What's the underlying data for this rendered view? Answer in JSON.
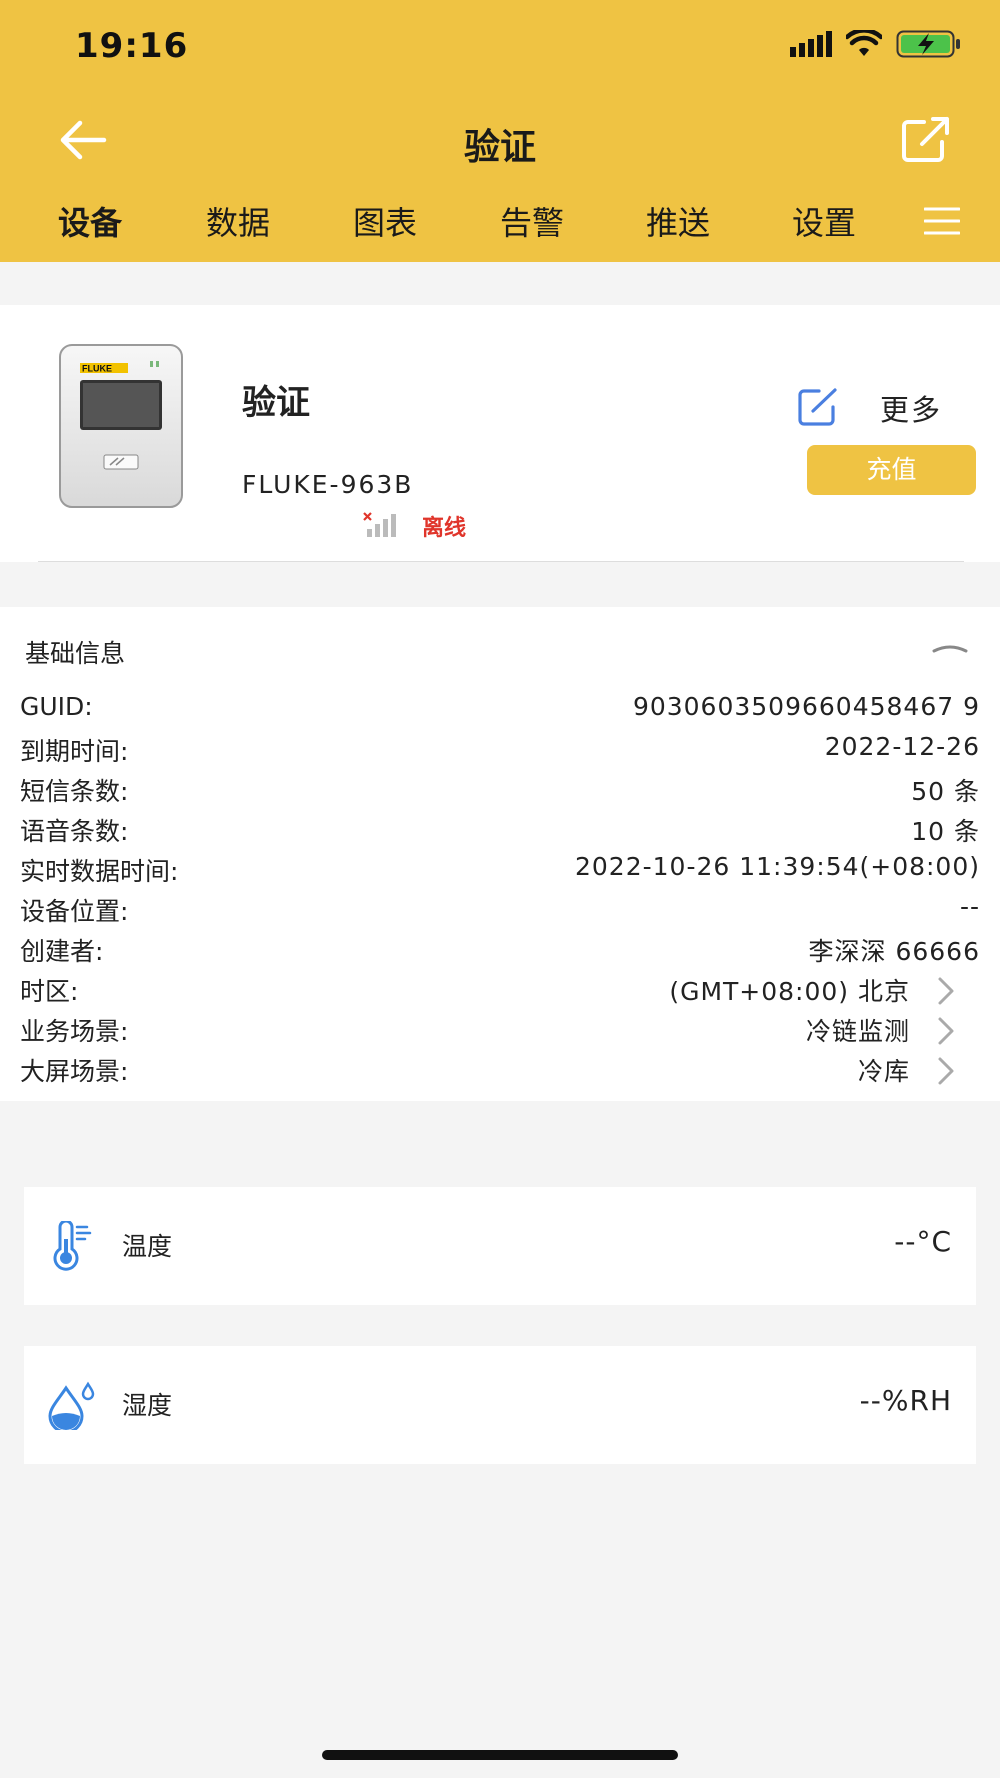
{
  "status_bar": {
    "time": "19:16"
  },
  "nav": {
    "title": "验证"
  },
  "tabs": [
    "设备",
    "数据",
    "图表",
    "告警",
    "推送",
    "设置"
  ],
  "device": {
    "name": "验证",
    "model": "FLUKE-963B",
    "status": "离线",
    "more_label": "更多",
    "recharge_label": "充值",
    "brand_on_image": "FLUKE"
  },
  "basic_info": {
    "title": "基础信息",
    "rows": [
      {
        "label": "GUID:",
        "value": "9030603509660458467 9"
      },
      {
        "label": "到期时间:",
        "value": "2022-12-26"
      },
      {
        "label": "短信条数:",
        "value": "50 条"
      },
      {
        "label": "语音条数:",
        "value": "10 条"
      },
      {
        "label": "实时数据时间:",
        "value": "2022-10-26 11:39:54(+08:00)"
      },
      {
        "label": "设备位置:",
        "value": "--"
      },
      {
        "label": "创建者:",
        "value": "李深深 66666"
      },
      {
        "label": "时区:",
        "value": "(GMT+08:00) 北京"
      },
      {
        "label": "业务场景:",
        "value": "冷链监测"
      },
      {
        "label": "大屏场景:",
        "value": "冷库"
      }
    ]
  },
  "sensors": [
    {
      "name": "温度",
      "value": "--°C",
      "icon": "thermometer-icon"
    },
    {
      "name": "湿度",
      "value": "--%RH",
      "icon": "humidity-drop-icon"
    }
  ],
  "colors": {
    "accent": "#efc343",
    "offline": "#e0352b",
    "icon_blue": "#3a86e0"
  }
}
